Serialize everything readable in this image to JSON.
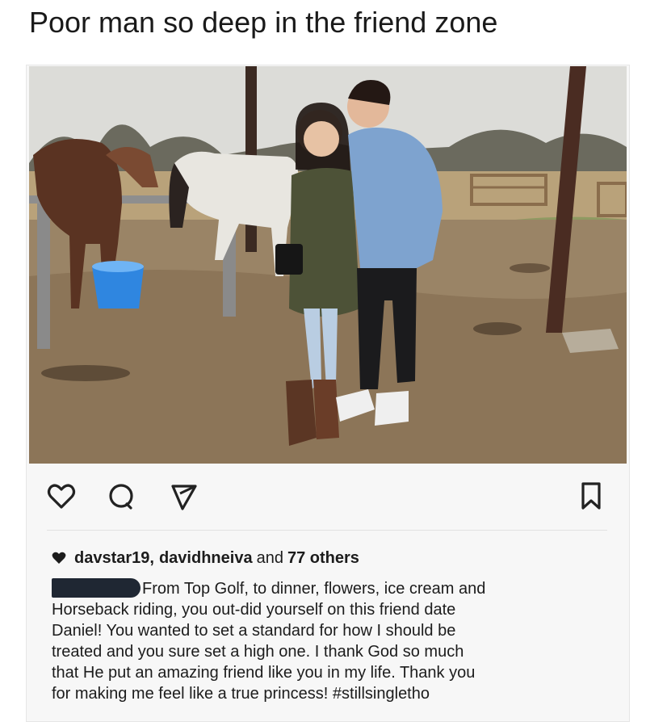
{
  "meme": {
    "title": "Poor man so deep in the friend zone"
  },
  "post": {
    "likes": {
      "user_1": "davstar19,",
      "user_2": "davidhneiva",
      "joiner": "and",
      "others": "77 others"
    },
    "caption_lines": [
      "From Top Golf, to dinner, flowers, ice cream and",
      "Horseback riding, you out-did yourself on this friend date",
      "Daniel! You wanted to set a standard for how I should be",
      "treated and you sure set a high one. I thank God so much",
      "that He put an amazing friend like you in my life. Thank you",
      "for making me feel like a true princess! #stillsingletho"
    ],
    "icons": {
      "like": "heart-icon",
      "comment": "comment-icon",
      "share": "share-icon",
      "save": "bookmark-icon",
      "liked_by": "small-heart-icon"
    },
    "colors": {
      "icon": "#222222",
      "redaction": "#1f2733"
    }
  }
}
